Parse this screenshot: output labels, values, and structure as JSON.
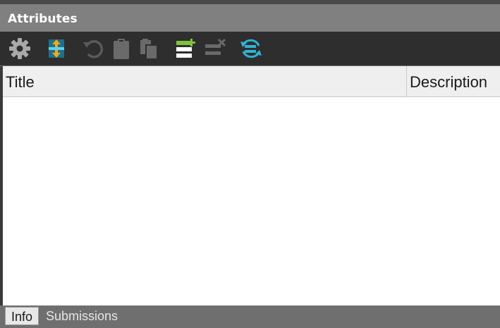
{
  "panel": {
    "title": "Attributes"
  },
  "toolbar": {
    "tools": [
      {
        "name": "settings",
        "icon": "gear-icon",
        "enabled": true
      },
      {
        "name": "move-up-down",
        "icon": "up-down-arrows-icon",
        "enabled": true
      },
      {
        "name": "undo",
        "icon": "undo-icon",
        "enabled": false
      },
      {
        "name": "paste",
        "icon": "clipboard-icon",
        "enabled": false
      },
      {
        "name": "copy",
        "icon": "copy-pages-icon",
        "enabled": false
      },
      {
        "name": "add-attribute",
        "icon": "add-row-icon",
        "enabled": true
      },
      {
        "name": "remove-attribute",
        "icon": "remove-row-icon",
        "enabled": false
      },
      {
        "name": "refresh",
        "icon": "refresh-cycle-icon",
        "enabled": true
      }
    ]
  },
  "grid": {
    "columns": [
      "Title",
      "Description"
    ],
    "rows": []
  },
  "tabs": [
    {
      "label": "Info",
      "active": true
    },
    {
      "label": "Submissions",
      "active": false
    }
  ],
  "colors": {
    "toolbar_bg": "#2e2e2e",
    "titlebar_bg": "#808080",
    "accent_green": "#7ec43a",
    "accent_blue": "#2fb3d6",
    "accent_orange": "#f0a81e"
  }
}
